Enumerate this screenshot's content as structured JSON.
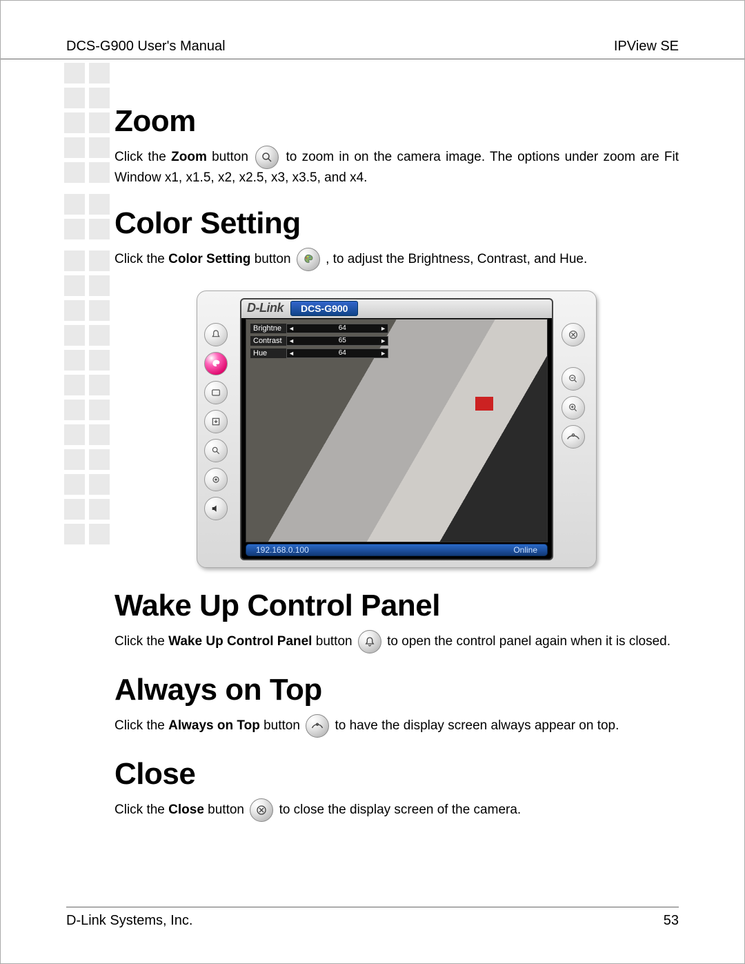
{
  "header": {
    "left": "DCS-G900 User's Manual",
    "right": "IPView SE"
  },
  "footer": {
    "left": "D-Link Systems, Inc.",
    "right": "53"
  },
  "sections": {
    "zoom": {
      "title": "Zoom",
      "t1": "Click the ",
      "b1": "Zoom",
      "t2": " button ",
      "t3": " to zoom in on the camera image. The options under zoom are Fit Window x1, x1.5, x2, x2.5, x3, x3.5, and x4."
    },
    "color": {
      "title": "Color Setting",
      "t1": "Click the ",
      "b1": "Color Setting",
      "t2": " button ",
      "t3": " , to adjust the Brightness, Contrast, and Hue."
    },
    "wake": {
      "title": "Wake Up Control Panel",
      "t1": "Click the ",
      "b1": "Wake Up Control Panel",
      "t2": " button ",
      "t3": " to open the control panel again when it is closed."
    },
    "top": {
      "title": "Always on Top",
      "t1": "Click the ",
      "b1": "Always on Top",
      "t2": " button ",
      "t3": " to have the display screen always appear on top."
    },
    "close": {
      "title": "Close",
      "t1": "Click the ",
      "b1": "Close",
      "t2": " button ",
      "t3": " to close the display screen of the camera."
    }
  },
  "app": {
    "brand": "D-Link",
    "model": "DCS-G900",
    "sliders": [
      {
        "label": "Brightne",
        "value": "64"
      },
      {
        "label": "Contrast",
        "value": "65"
      },
      {
        "label": "Hue",
        "value": "64"
      }
    ],
    "status": {
      "ip": "192.168.0.100",
      "state": "Online"
    }
  }
}
